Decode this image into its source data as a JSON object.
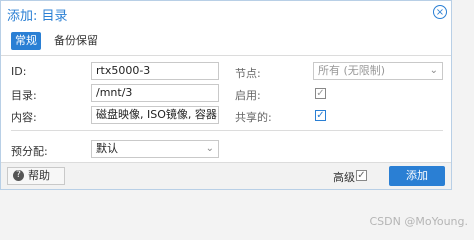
{
  "dialog": {
    "title": "添加: 目录",
    "close_symbol": "×"
  },
  "tabs": [
    {
      "label": "常规",
      "active": true
    },
    {
      "label": "备份保留",
      "active": false
    }
  ],
  "form": {
    "id": {
      "label": "ID:",
      "value": "rtx5000-3"
    },
    "directory": {
      "label": "目录:",
      "value": "/mnt/3"
    },
    "content": {
      "label": "内容:",
      "value": "磁盘映像, ISO镜像, 容器"
    },
    "nodes": {
      "label": "节点:",
      "value": "所有 (无限制)"
    },
    "enabled": {
      "label": "启用:",
      "checked": true
    },
    "shared": {
      "label": "共享的:",
      "checked": true
    },
    "prealloc": {
      "label": "预分配:",
      "value": "默认"
    }
  },
  "footer": {
    "help_label": "帮助",
    "help_icon": "?",
    "advanced_label": "高级",
    "advanced_checked": true,
    "add_label": "添加"
  },
  "watermark": "CSDN @MoYoung.",
  "colors": {
    "accent": "#2a7fd4"
  }
}
